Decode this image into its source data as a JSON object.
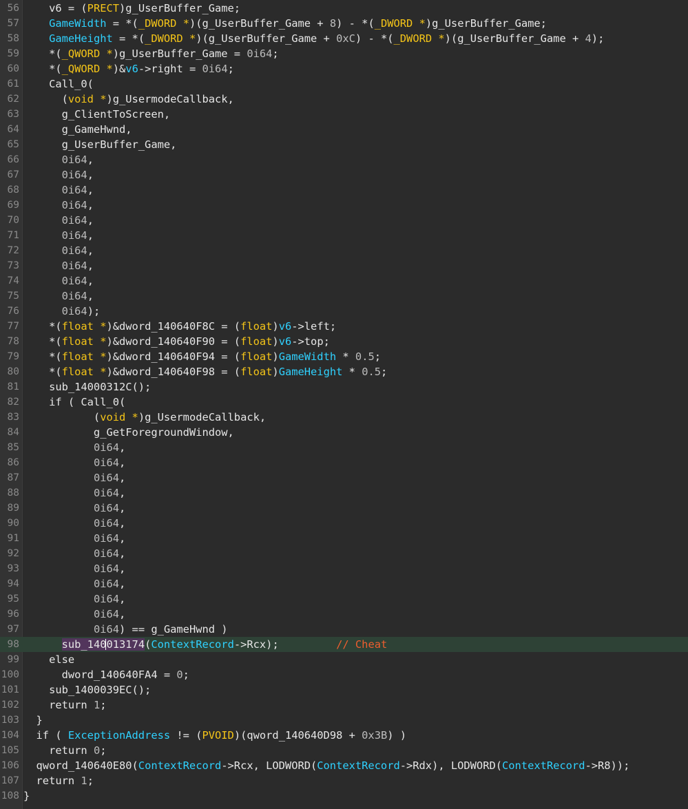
{
  "lines": [
    {
      "n": "56",
      "segs": [
        {
          "t": "    v6 = (",
          "k": "s"
        },
        {
          "t": "PRECT",
          "k": "t"
        },
        {
          "t": ")g_UserBuffer_Game;",
          "k": "s"
        }
      ]
    },
    {
      "n": "57",
      "segs": [
        {
          "t": "    ",
          "k": "s"
        },
        {
          "t": "GameWidth",
          "k": "v"
        },
        {
          "t": " = *(",
          "k": "s"
        },
        {
          "t": "_DWORD *",
          "k": "t"
        },
        {
          "t": ")(g_UserBuffer_Game + ",
          "k": "s"
        },
        {
          "t": "8",
          "k": "n"
        },
        {
          "t": ") - *(",
          "k": "s"
        },
        {
          "t": "_DWORD *",
          "k": "t"
        },
        {
          "t": ")g_UserBuffer_Game;",
          "k": "s"
        }
      ]
    },
    {
      "n": "58",
      "segs": [
        {
          "t": "    ",
          "k": "s"
        },
        {
          "t": "GameHeight",
          "k": "v"
        },
        {
          "t": " = *(",
          "k": "s"
        },
        {
          "t": "_DWORD *",
          "k": "t"
        },
        {
          "t": ")(g_UserBuffer_Game + ",
          "k": "s"
        },
        {
          "t": "0xC",
          "k": "n"
        },
        {
          "t": ") - *(",
          "k": "s"
        },
        {
          "t": "_DWORD *",
          "k": "t"
        },
        {
          "t": ")(g_UserBuffer_Game + ",
          "k": "s"
        },
        {
          "t": "4",
          "k": "n"
        },
        {
          "t": ");",
          "k": "s"
        }
      ]
    },
    {
      "n": "59",
      "segs": [
        {
          "t": "    *(",
          "k": "s"
        },
        {
          "t": "_QWORD *",
          "k": "t"
        },
        {
          "t": ")g_UserBuffer_Game = ",
          "k": "s"
        },
        {
          "t": "0i64",
          "k": "n"
        },
        {
          "t": ";",
          "k": "s"
        }
      ]
    },
    {
      "n": "60",
      "segs": [
        {
          "t": "    *(",
          "k": "s"
        },
        {
          "t": "_QWORD *",
          "k": "t"
        },
        {
          "t": ")&",
          "k": "s"
        },
        {
          "t": "v6",
          "k": "v"
        },
        {
          "t": "->right = ",
          "k": "s"
        },
        {
          "t": "0i64",
          "k": "n"
        },
        {
          "t": ";",
          "k": "s"
        }
      ]
    },
    {
      "n": "61",
      "segs": [
        {
          "t": "    Call_0(",
          "k": "s"
        }
      ]
    },
    {
      "n": "62",
      "segs": [
        {
          "t": "      (",
          "k": "s"
        },
        {
          "t": "void *",
          "k": "t"
        },
        {
          "t": ")g_UsermodeCallback,",
          "k": "s"
        }
      ]
    },
    {
      "n": "63",
      "segs": [
        {
          "t": "      g_ClientToScreen,",
          "k": "s"
        }
      ]
    },
    {
      "n": "64",
      "segs": [
        {
          "t": "      g_GameHwnd,",
          "k": "s"
        }
      ]
    },
    {
      "n": "65",
      "segs": [
        {
          "t": "      g_UserBuffer_Game,",
          "k": "s"
        }
      ]
    },
    {
      "n": "66",
      "segs": [
        {
          "t": "      ",
          "k": "s"
        },
        {
          "t": "0i64",
          "k": "n"
        },
        {
          "t": ",",
          "k": "s"
        }
      ]
    },
    {
      "n": "67",
      "segs": [
        {
          "t": "      ",
          "k": "s"
        },
        {
          "t": "0i64",
          "k": "n"
        },
        {
          "t": ",",
          "k": "s"
        }
      ]
    },
    {
      "n": "68",
      "segs": [
        {
          "t": "      ",
          "k": "s"
        },
        {
          "t": "0i64",
          "k": "n"
        },
        {
          "t": ",",
          "k": "s"
        }
      ]
    },
    {
      "n": "69",
      "segs": [
        {
          "t": "      ",
          "k": "s"
        },
        {
          "t": "0i64",
          "k": "n"
        },
        {
          "t": ",",
          "k": "s"
        }
      ]
    },
    {
      "n": "70",
      "segs": [
        {
          "t": "      ",
          "k": "s"
        },
        {
          "t": "0i64",
          "k": "n"
        },
        {
          "t": ",",
          "k": "s"
        }
      ]
    },
    {
      "n": "71",
      "segs": [
        {
          "t": "      ",
          "k": "s"
        },
        {
          "t": "0i64",
          "k": "n"
        },
        {
          "t": ",",
          "k": "s"
        }
      ]
    },
    {
      "n": "72",
      "segs": [
        {
          "t": "      ",
          "k": "s"
        },
        {
          "t": "0i64",
          "k": "n"
        },
        {
          "t": ",",
          "k": "s"
        }
      ]
    },
    {
      "n": "73",
      "segs": [
        {
          "t": "      ",
          "k": "s"
        },
        {
          "t": "0i64",
          "k": "n"
        },
        {
          "t": ",",
          "k": "s"
        }
      ]
    },
    {
      "n": "74",
      "segs": [
        {
          "t": "      ",
          "k": "s"
        },
        {
          "t": "0i64",
          "k": "n"
        },
        {
          "t": ",",
          "k": "s"
        }
      ]
    },
    {
      "n": "75",
      "segs": [
        {
          "t": "      ",
          "k": "s"
        },
        {
          "t": "0i64",
          "k": "n"
        },
        {
          "t": ",",
          "k": "s"
        }
      ]
    },
    {
      "n": "76",
      "segs": [
        {
          "t": "      ",
          "k": "s"
        },
        {
          "t": "0i64",
          "k": "n"
        },
        {
          "t": ");",
          "k": "s"
        }
      ]
    },
    {
      "n": "77",
      "segs": [
        {
          "t": "    *(",
          "k": "s"
        },
        {
          "t": "float *",
          "k": "t"
        },
        {
          "t": ")&dword_140640F8C = (",
          "k": "s"
        },
        {
          "t": "float",
          "k": "t"
        },
        {
          "t": ")",
          "k": "s"
        },
        {
          "t": "v6",
          "k": "v"
        },
        {
          "t": "->left;",
          "k": "s"
        }
      ]
    },
    {
      "n": "78",
      "segs": [
        {
          "t": "    *(",
          "k": "s"
        },
        {
          "t": "float *",
          "k": "t"
        },
        {
          "t": ")&dword_140640F90 = (",
          "k": "s"
        },
        {
          "t": "float",
          "k": "t"
        },
        {
          "t": ")",
          "k": "s"
        },
        {
          "t": "v6",
          "k": "v"
        },
        {
          "t": "->top;",
          "k": "s"
        }
      ]
    },
    {
      "n": "79",
      "segs": [
        {
          "t": "    *(",
          "k": "s"
        },
        {
          "t": "float *",
          "k": "t"
        },
        {
          "t": ")&dword_140640F94 = (",
          "k": "s"
        },
        {
          "t": "float",
          "k": "t"
        },
        {
          "t": ")",
          "k": "s"
        },
        {
          "t": "GameWidth",
          "k": "v"
        },
        {
          "t": " * ",
          "k": "s"
        },
        {
          "t": "0.5",
          "k": "n"
        },
        {
          "t": ";",
          "k": "s"
        }
      ]
    },
    {
      "n": "80",
      "segs": [
        {
          "t": "    *(",
          "k": "s"
        },
        {
          "t": "float *",
          "k": "t"
        },
        {
          "t": ")&dword_140640F98 = (",
          "k": "s"
        },
        {
          "t": "float",
          "k": "t"
        },
        {
          "t": ")",
          "k": "s"
        },
        {
          "t": "GameHeight",
          "k": "v"
        },
        {
          "t": " * ",
          "k": "s"
        },
        {
          "t": "0.5",
          "k": "n"
        },
        {
          "t": ";",
          "k": "s"
        }
      ]
    },
    {
      "n": "81",
      "segs": [
        {
          "t": "    sub_14000312C();",
          "k": "s"
        }
      ]
    },
    {
      "n": "82",
      "segs": [
        {
          "t": "    if ( Call_0(",
          "k": "s"
        }
      ]
    },
    {
      "n": "83",
      "segs": [
        {
          "t": "           (",
          "k": "s"
        },
        {
          "t": "void *",
          "k": "t"
        },
        {
          "t": ")g_UsermodeCallback,",
          "k": "s"
        }
      ]
    },
    {
      "n": "84",
      "segs": [
        {
          "t": "           g_GetForegroundWindow,",
          "k": "s"
        }
      ]
    },
    {
      "n": "85",
      "segs": [
        {
          "t": "           ",
          "k": "s"
        },
        {
          "t": "0i64",
          "k": "n"
        },
        {
          "t": ",",
          "k": "s"
        }
      ]
    },
    {
      "n": "86",
      "segs": [
        {
          "t": "           ",
          "k": "s"
        },
        {
          "t": "0i64",
          "k": "n"
        },
        {
          "t": ",",
          "k": "s"
        }
      ]
    },
    {
      "n": "87",
      "segs": [
        {
          "t": "           ",
          "k": "s"
        },
        {
          "t": "0i64",
          "k": "n"
        },
        {
          "t": ",",
          "k": "s"
        }
      ]
    },
    {
      "n": "88",
      "segs": [
        {
          "t": "           ",
          "k": "s"
        },
        {
          "t": "0i64",
          "k": "n"
        },
        {
          "t": ",",
          "k": "s"
        }
      ]
    },
    {
      "n": "89",
      "segs": [
        {
          "t": "           ",
          "k": "s"
        },
        {
          "t": "0i64",
          "k": "n"
        },
        {
          "t": ",",
          "k": "s"
        }
      ]
    },
    {
      "n": "90",
      "segs": [
        {
          "t": "           ",
          "k": "s"
        },
        {
          "t": "0i64",
          "k": "n"
        },
        {
          "t": ",",
          "k": "s"
        }
      ]
    },
    {
      "n": "91",
      "segs": [
        {
          "t": "           ",
          "k": "s"
        },
        {
          "t": "0i64",
          "k": "n"
        },
        {
          "t": ",",
          "k": "s"
        }
      ]
    },
    {
      "n": "92",
      "segs": [
        {
          "t": "           ",
          "k": "s"
        },
        {
          "t": "0i64",
          "k": "n"
        },
        {
          "t": ",",
          "k": "s"
        }
      ]
    },
    {
      "n": "93",
      "segs": [
        {
          "t": "           ",
          "k": "s"
        },
        {
          "t": "0i64",
          "k": "n"
        },
        {
          "t": ",",
          "k": "s"
        }
      ]
    },
    {
      "n": "94",
      "segs": [
        {
          "t": "           ",
          "k": "s"
        },
        {
          "t": "0i64",
          "k": "n"
        },
        {
          "t": ",",
          "k": "s"
        }
      ]
    },
    {
      "n": "95",
      "segs": [
        {
          "t": "           ",
          "k": "s"
        },
        {
          "t": "0i64",
          "k": "n"
        },
        {
          "t": ",",
          "k": "s"
        }
      ]
    },
    {
      "n": "96",
      "segs": [
        {
          "t": "           ",
          "k": "s"
        },
        {
          "t": "0i64",
          "k": "n"
        },
        {
          "t": ",",
          "k": "s"
        }
      ]
    },
    {
      "n": "97",
      "segs": [
        {
          "t": "           ",
          "k": "s"
        },
        {
          "t": "0i64",
          "k": "n"
        },
        {
          "t": ") == g_GameHwnd )",
          "k": "s"
        }
      ]
    },
    {
      "n": "98",
      "highlight": true,
      "segs": [
        {
          "t": "      ",
          "k": "s"
        },
        {
          "t": "sub_140",
          "k": "w"
        },
        {
          "t": "",
          "k": "caret"
        },
        {
          "t": "013174",
          "k": "w"
        },
        {
          "t": "(",
          "k": "s"
        },
        {
          "t": "ContextRecord",
          "k": "v"
        },
        {
          "t": "->Rcx);         ",
          "k": "s"
        },
        {
          "t": "// Cheat",
          "k": "c"
        }
      ]
    },
    {
      "n": "99",
      "segs": [
        {
          "t": "    else",
          "k": "s"
        }
      ]
    },
    {
      "n": "100",
      "segs": [
        {
          "t": "      dword_140640FA4 = ",
          "k": "s"
        },
        {
          "t": "0",
          "k": "n"
        },
        {
          "t": ";",
          "k": "s"
        }
      ]
    },
    {
      "n": "101",
      "segs": [
        {
          "t": "    sub_1400039EC();",
          "k": "s"
        }
      ]
    },
    {
      "n": "102",
      "segs": [
        {
          "t": "    return ",
          "k": "s"
        },
        {
          "t": "1",
          "k": "n"
        },
        {
          "t": ";",
          "k": "s"
        }
      ]
    },
    {
      "n": "103",
      "segs": [
        {
          "t": "  }",
          "k": "s"
        }
      ]
    },
    {
      "n": "104",
      "segs": [
        {
          "t": "  if ( ",
          "k": "s"
        },
        {
          "t": "ExceptionAddress",
          "k": "v"
        },
        {
          "t": " != (",
          "k": "s"
        },
        {
          "t": "PVOID",
          "k": "t"
        },
        {
          "t": ")(qword_140640D98 + ",
          "k": "s"
        },
        {
          "t": "0x3B",
          "k": "n"
        },
        {
          "t": ") )",
          "k": "s"
        }
      ]
    },
    {
      "n": "105",
      "segs": [
        {
          "t": "    return ",
          "k": "s"
        },
        {
          "t": "0",
          "k": "n"
        },
        {
          "t": ";",
          "k": "s"
        }
      ]
    },
    {
      "n": "106",
      "segs": [
        {
          "t": "  qword_140640E80(",
          "k": "s"
        },
        {
          "t": "ContextRecord",
          "k": "v"
        },
        {
          "t": "->Rcx, LODWORD(",
          "k": "s"
        },
        {
          "t": "ContextRecord",
          "k": "v"
        },
        {
          "t": "->Rdx), LODWORD(",
          "k": "s"
        },
        {
          "t": "ContextRecord",
          "k": "v"
        },
        {
          "t": "->R8));",
          "k": "s"
        }
      ]
    },
    {
      "n": "107",
      "segs": [
        {
          "t": "  return ",
          "k": "s"
        },
        {
          "t": "1",
          "k": "n"
        },
        {
          "t": ";",
          "k": "s"
        }
      ]
    },
    {
      "n": "108",
      "segs": [
        {
          "t": "}",
          "k": "s"
        }
      ]
    }
  ],
  "colors": {
    "background": "#2b2b2b",
    "plain": "#e6e6e6",
    "type": "#f5c518",
    "variable": "#2fd1ff",
    "number": "#bdbdbd",
    "comment": "#ee5e2f",
    "current_line": "#2e4236",
    "word_highlight": "#52355c"
  }
}
